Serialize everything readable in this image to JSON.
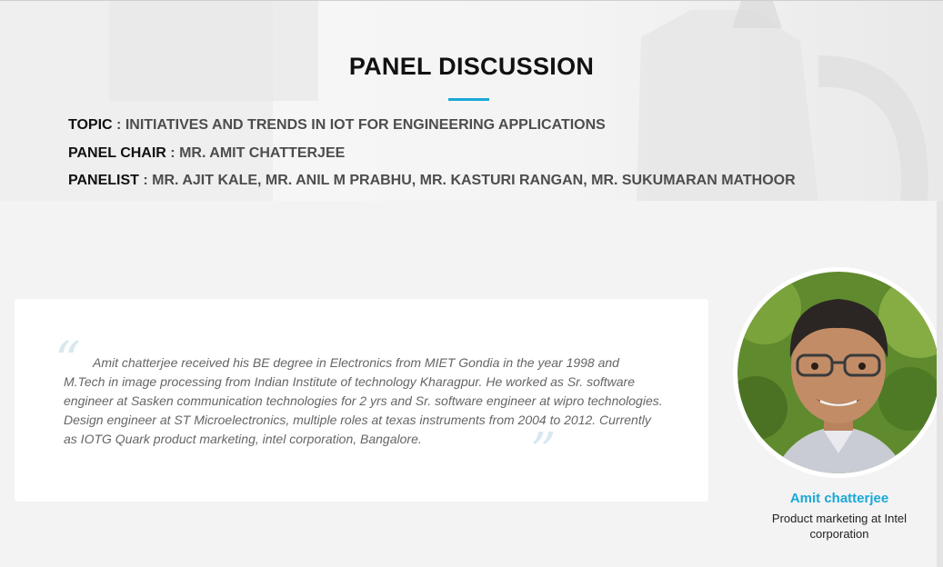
{
  "section": {
    "title": "PANEL DISCUSSION"
  },
  "info": {
    "topic_label": "TOPIC",
    "topic_value": "INITIATIVES AND TRENDS IN IOT FOR ENGINEERING APPLICATIONS",
    "chair_label": "PANEL CHAIR",
    "chair_value": "MR. AMIT CHATTERJEE",
    "panelist_label": "PANELIST",
    "panelist_value": "MR. AJIT KALE, MR. ANIL M PRABHU, MR. KASTURI RANGAN, MR. SUKUMARAN MATHOOR",
    "separator": " : "
  },
  "testimonial": {
    "open_quote": "“",
    "close_quote": "”",
    "text": "Amit chatterjee received his BE degree in Electronics from MIET Gondia in the year 1998 and M.Tech in image processing from Indian Institute of technology Kharagpur. He worked as Sr. software engineer at Sasken communication technologies for 2 yrs and Sr. software engineer at wipro technologies. Design engineer at ST Microelectronics, multiple roles at texas instruments from 2004 to 2012. Currently as IOTG Quark product marketing, intel corporation, Bangalore."
  },
  "person": {
    "name": "Amit chatterjee",
    "role": "Product marketing at Intel corporation"
  },
  "colors": {
    "accent": "#1aa8d8",
    "heading": "#111111",
    "body_text": "#666666"
  }
}
